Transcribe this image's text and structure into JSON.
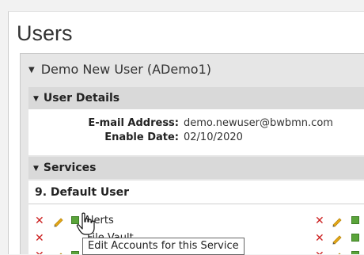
{
  "page": {
    "title": "Users"
  },
  "user": {
    "name": "Demo New User (ADemo1)",
    "sections": {
      "details": {
        "title": "User Details",
        "email_label": "E-mail Address:",
        "email_value": "demo.newuser@bwbmn.com",
        "enable_label": "Enable Date:",
        "enable_value": "02/10/2020"
      },
      "services": {
        "title": "Services",
        "group": "9. Default User",
        "rows": [
          {
            "name": "Alerts"
          },
          {
            "name": "File Vault"
          }
        ]
      }
    }
  },
  "tooltip": {
    "text": "Edit Accounts for this Service"
  },
  "colors": {
    "delete": "#cc1f1f",
    "edit": "#e6a817",
    "service": "#5aa43a",
    "panel": "#e6e6e6",
    "section": "#d9d9d9"
  },
  "icons": {
    "delete": "x-icon",
    "edit": "pencil-icon",
    "service": "service-square-icon",
    "cursor": "hand-pointer-icon"
  }
}
